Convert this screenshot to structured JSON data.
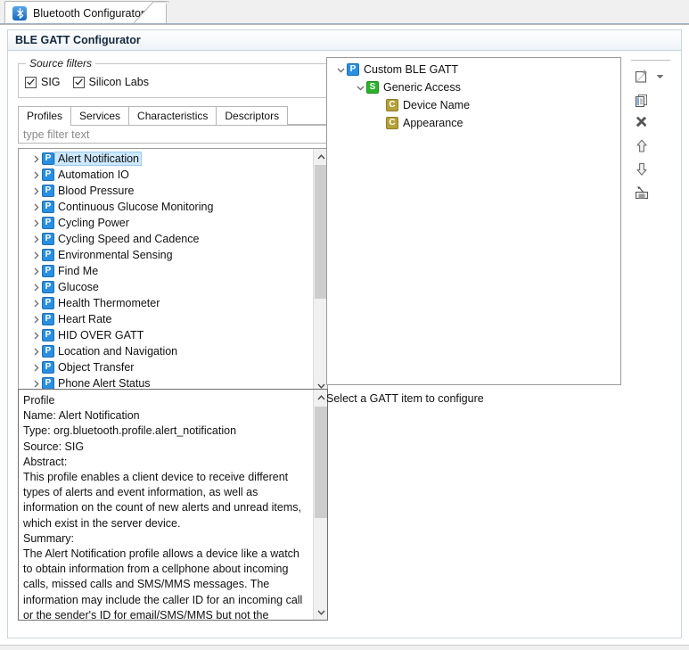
{
  "window": {
    "editor_tab": {
      "title": "Bluetooth Configurator",
      "icon": "bluetooth-icon"
    },
    "form_title": "BLE GATT Configurator"
  },
  "source_filters": {
    "legend": "Source filters",
    "options": [
      {
        "label": "SIG",
        "checked": true
      },
      {
        "label": "Silicon Labs",
        "checked": true
      }
    ]
  },
  "catalog": {
    "tabs": [
      {
        "label": "Profiles",
        "selected": true
      },
      {
        "label": "Services",
        "selected": false
      },
      {
        "label": "Characteristics",
        "selected": false
      },
      {
        "label": "Descriptors",
        "selected": false
      }
    ],
    "filter": {
      "placeholder": "type filter text",
      "value": ""
    },
    "items": [
      {
        "label": "Alert Notification",
        "badge": "P",
        "selected": true
      },
      {
        "label": "Automation IO",
        "badge": "P",
        "selected": false
      },
      {
        "label": "Blood Pressure",
        "badge": "P",
        "selected": false
      },
      {
        "label": "Continuous Glucose Monitoring",
        "badge": "P",
        "selected": false
      },
      {
        "label": "Cycling Power",
        "badge": "P",
        "selected": false
      },
      {
        "label": "Cycling Speed and Cadence",
        "badge": "P",
        "selected": false
      },
      {
        "label": "Environmental Sensing",
        "badge": "P",
        "selected": false
      },
      {
        "label": "Find Me",
        "badge": "P",
        "selected": false
      },
      {
        "label": "Glucose",
        "badge": "P",
        "selected": false
      },
      {
        "label": "Health Thermometer",
        "badge": "P",
        "selected": false
      },
      {
        "label": "Heart Rate",
        "badge": "P",
        "selected": false
      },
      {
        "label": "HID OVER GATT",
        "badge": "P",
        "selected": false
      },
      {
        "label": "Location and Navigation",
        "badge": "P",
        "selected": false
      },
      {
        "label": "Object Transfer",
        "badge": "P",
        "selected": false
      },
      {
        "label": "Phone Alert Status",
        "badge": "P",
        "selected": false
      }
    ]
  },
  "details": {
    "text": "Profile\nName: Alert Notification\nType: org.bluetooth.profile.alert_notification\nSource: SIG\nAbstract:\nThis profile enables a client device to receive different types of alerts and event information, as well as information on the count of new alerts and unread items, which exist in the server device.\nSummary:\nThe Alert Notification profile allows a device like a watch to obtain information from a cellphone about incoming calls, missed calls and SMS/MMS messages. The information may include the caller ID for an incoming call or the sender's ID for email/SMS/MMS but not the message. This profile also enables the client device to get"
  },
  "gatt_tree": {
    "nodes": [
      {
        "label": "Custom BLE GATT",
        "badge": "P",
        "depth": 0,
        "expanded": true
      },
      {
        "label": "Generic Access",
        "badge": "S",
        "depth": 1,
        "expanded": true
      },
      {
        "label": "Device Name",
        "badge": "C",
        "depth": 2,
        "expanded": null
      },
      {
        "label": "Appearance",
        "badge": "C",
        "depth": 2,
        "expanded": null
      }
    ]
  },
  "configure_hint": "Select a GATT item to configure",
  "toolbar": {
    "buttons": [
      {
        "name": "new-item-button",
        "icon": "new-document-icon",
        "has_dropdown": true
      },
      {
        "name": "copy-button",
        "icon": "copy-icon",
        "has_dropdown": false
      },
      {
        "name": "delete-button",
        "icon": "delete-x-icon",
        "has_dropdown": false
      },
      {
        "name": "move-up-button",
        "icon": "arrow-up-icon",
        "has_dropdown": false
      },
      {
        "name": "move-down-button",
        "icon": "arrow-down-icon",
        "has_dropdown": false
      },
      {
        "name": "import-button",
        "icon": "import-icon",
        "has_dropdown": false
      }
    ]
  },
  "colors": {
    "accent": "#2a8fe0",
    "service": "#2cb22c",
    "characteristic": "#b5a13a",
    "selection": "#cde8ff",
    "header_border": "#c8d6e2"
  }
}
